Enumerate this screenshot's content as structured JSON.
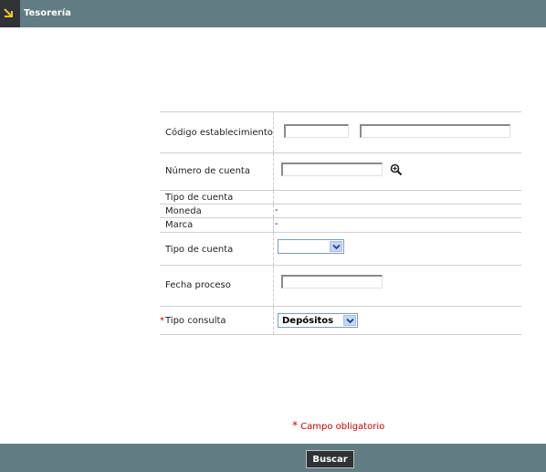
{
  "header": {
    "title": "Tesorería",
    "icon": "arrow-corner-icon"
  },
  "form": {
    "codigo_establecimiento": {
      "label": "Código establecimiento",
      "value1": "",
      "value2": ""
    },
    "numero_cuenta": {
      "label": "Número de cuenta",
      "value": "",
      "search_icon": "magnifier-icon"
    },
    "tipo_cuenta_info": {
      "label": "Tipo de cuenta",
      "value": ""
    },
    "moneda": {
      "label": "Moneda",
      "value": "-"
    },
    "marca": {
      "label": "Marca",
      "value": "-"
    },
    "tipo_cuenta": {
      "label": "Tipo de cuenta",
      "selected": ""
    },
    "fecha_proceso": {
      "label": "Fecha proceso",
      "value": ""
    },
    "tipo_consulta": {
      "required_mark": "*",
      "label": "Tipo consulta",
      "selected": "Depósitos"
    }
  },
  "required_note": {
    "star": "*",
    "text": "Campo obligatorio"
  },
  "footer": {
    "search_button": "Buscar"
  },
  "colors": {
    "bar": "#617c83",
    "dark": "#2f3335",
    "required": "#cc0000"
  }
}
